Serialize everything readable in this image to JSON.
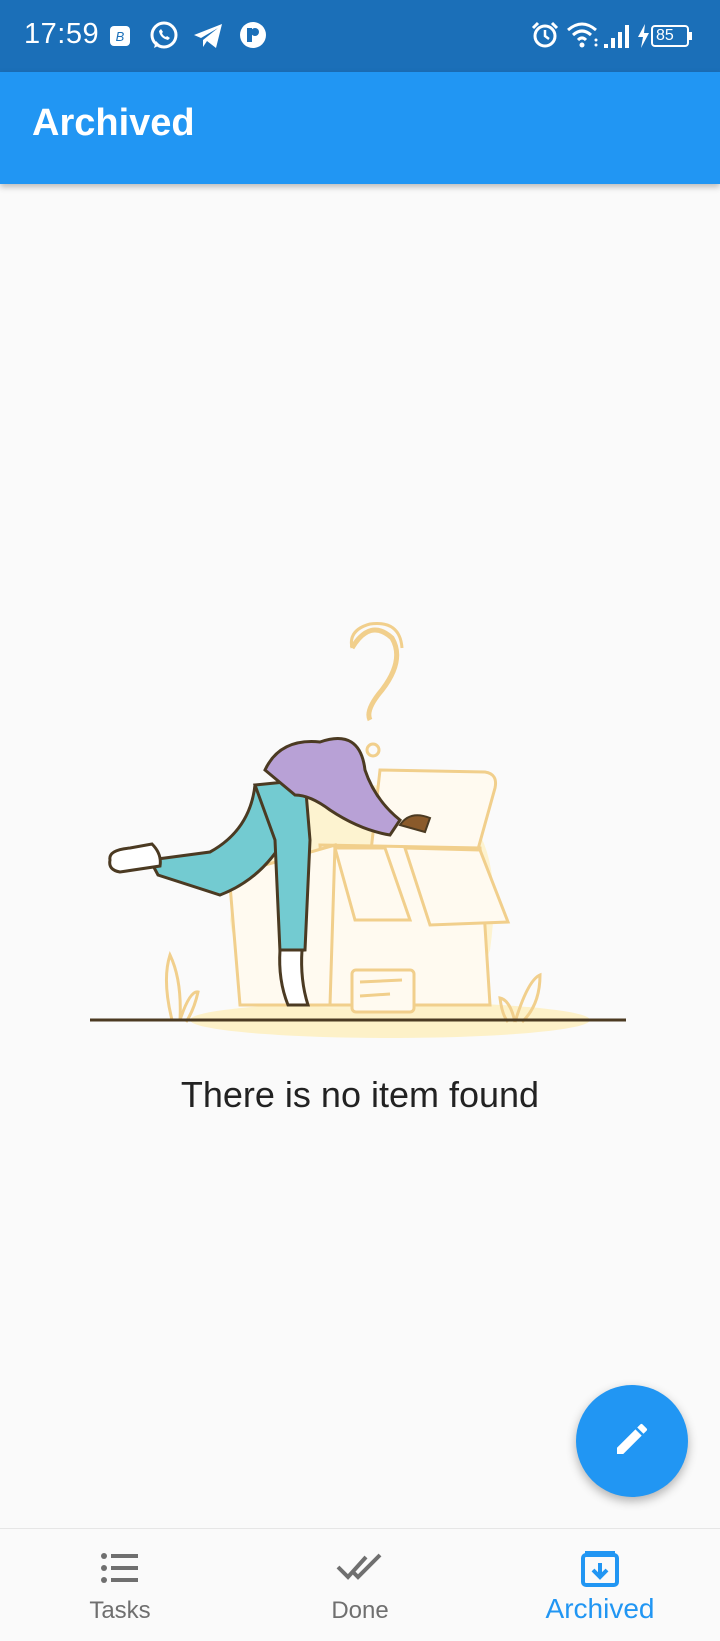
{
  "status_bar": {
    "time": "17:59",
    "battery": "85",
    "icons": [
      "b-app-icon",
      "whatsapp-icon",
      "telegram-icon",
      "app-icon",
      "alarm-icon",
      "wifi-icon",
      "signal-icon",
      "battery-charging-icon"
    ]
  },
  "app_bar": {
    "title": "Archived"
  },
  "empty_state": {
    "message": "There is no item found",
    "illustration": "person-searching-box"
  },
  "fab": {
    "icon": "edit-icon"
  },
  "bottom_nav": {
    "items": [
      {
        "label": "Tasks",
        "icon": "list-icon",
        "active": false
      },
      {
        "label": "Done",
        "icon": "double-check-icon",
        "active": false
      },
      {
        "label": "Archived",
        "icon": "archive-icon",
        "active": true
      }
    ]
  },
  "colors": {
    "primary": "#2196f3",
    "status_bar": "#1b6fb8",
    "inactive": "#6f6f6f",
    "background": "#fafafa"
  }
}
